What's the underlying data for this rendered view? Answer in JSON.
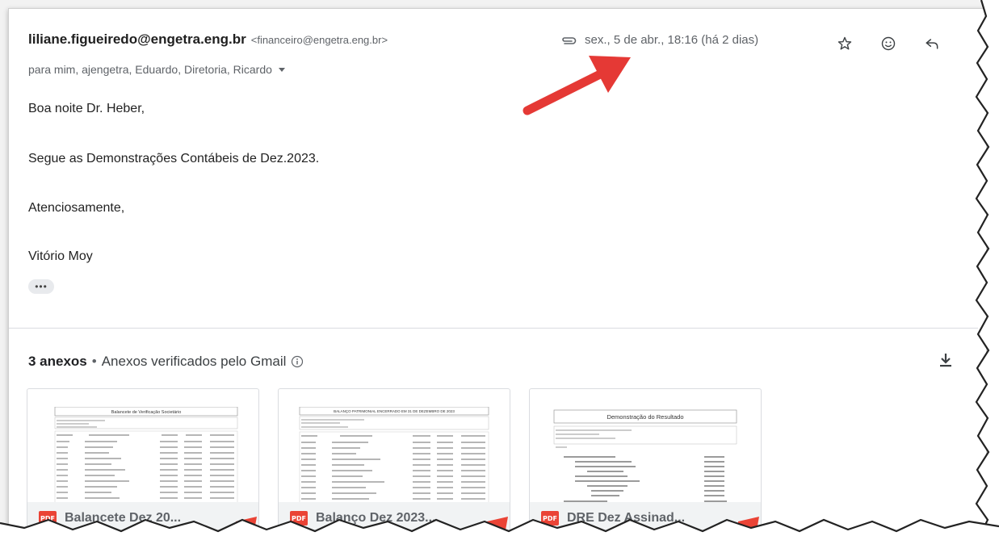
{
  "email": {
    "sender_name": "liliane.figueiredo@engetra.eng.br",
    "sender_email": "<financeiro@engetra.eng.br>",
    "date": "sex., 5 de abr., 18:16 (há 2 dias)",
    "recipients": "para mim, ajengetra, Eduardo, Diretoria, Ricardo",
    "body": {
      "greeting": "Boa noite Dr. Heber,",
      "line1": "Segue as Demonstrações Contábeis de Dez.2023.",
      "closing": "Atenciosamente,",
      "signature": "Vitório Moy"
    },
    "more_label": "•••"
  },
  "icons": {
    "attachment": "paperclip-icon",
    "star": "star-icon",
    "emoji": "emoji-icon",
    "reply": "reply-icon",
    "download": "download-icon",
    "info": "info-icon"
  },
  "attachments": {
    "count_label": "3 anexos",
    "separator": "•",
    "verified_label": "Anexos verificados pelo Gmail",
    "items": [
      {
        "name": "Balancete Dez 20...",
        "badge": "PDF",
        "thumb_title": "Balancete de Verificação Societário"
      },
      {
        "name": "Balanço Dez 2023...",
        "badge": "PDF",
        "thumb_title": "BALANÇO PATRIMONIAL ENCERRADO EM 31 DE DEZEMBRO DE 2023"
      },
      {
        "name": "DRE Dez Assinad...",
        "badge": "PDF",
        "thumb_title": "Demonstração do Resultado"
      }
    ]
  },
  "colors": {
    "pdf_red": "#ea4335",
    "arrow_red": "#e53935",
    "muted_text": "#5f6368"
  }
}
